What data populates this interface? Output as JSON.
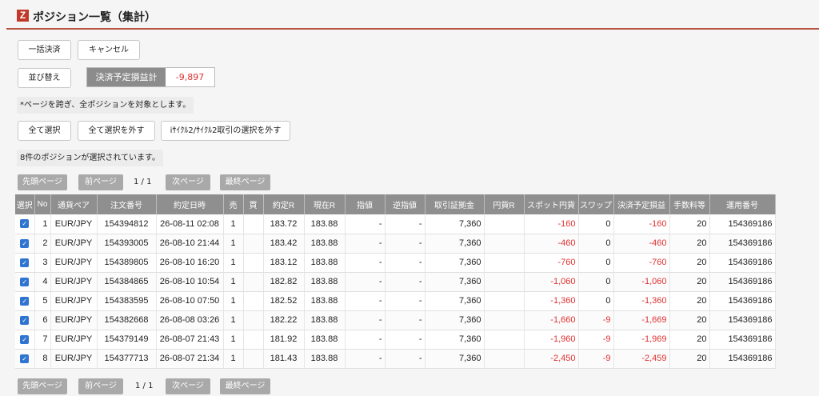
{
  "header": {
    "logo": "Z",
    "title": "ポジション一覧（集計）"
  },
  "actions": {
    "bulk_settle": "一括決済",
    "cancel": "キャンセル",
    "sort": "並び替え",
    "pl_label": "決済予定損益計",
    "pl_value": "-9,897"
  },
  "notes": {
    "scope": "*ページを跨ぎ、全ポジションを対象とします。",
    "selected_count": "8件のポジションが選択されています。"
  },
  "selection": {
    "select_all": "全て選択",
    "deselect_all": "全て選択を外す",
    "deselect_icycle": "iｻｲｸﾙ2/ｻｲｸﾙ2取引の選択を外す"
  },
  "pager": {
    "first": "先頭ページ",
    "prev": "前ページ",
    "indicator": "1 / 1",
    "next": "次ページ",
    "last": "最終ページ"
  },
  "table": {
    "headers": [
      "選択",
      "No",
      "通貨ペア",
      "注文番号",
      "約定日時",
      "売",
      "買",
      "約定R",
      "現在R",
      "指値",
      "逆指値",
      "取引証拠金",
      "円貨R",
      "スポット円貨",
      "スワップ",
      "決済予定損益",
      "手数料等",
      "運用番号"
    ],
    "rows": [
      [
        "1",
        "EUR/JPY",
        "154394812",
        "26-08-11 02:08",
        "1",
        "",
        "183.72",
        "183.88",
        "-",
        "-",
        "7,360",
        "",
        "-160",
        "0",
        "-160",
        "20",
        "154369186"
      ],
      [
        "2",
        "EUR/JPY",
        "154393005",
        "26-08-10 21:44",
        "1",
        "",
        "183.42",
        "183.88",
        "-",
        "-",
        "7,360",
        "",
        "-460",
        "0",
        "-460",
        "20",
        "154369186"
      ],
      [
        "3",
        "EUR/JPY",
        "154389805",
        "26-08-10 16:20",
        "1",
        "",
        "183.12",
        "183.88",
        "-",
        "-",
        "7,360",
        "",
        "-760",
        "0",
        "-760",
        "20",
        "154369186"
      ],
      [
        "4",
        "EUR/JPY",
        "154384865",
        "26-08-10 10:54",
        "1",
        "",
        "182.82",
        "183.88",
        "-",
        "-",
        "7,360",
        "",
        "-1,060",
        "0",
        "-1,060",
        "20",
        "154369186"
      ],
      [
        "5",
        "EUR/JPY",
        "154383595",
        "26-08-10 07:50",
        "1",
        "",
        "182.52",
        "183.88",
        "-",
        "-",
        "7,360",
        "",
        "-1,360",
        "0",
        "-1,360",
        "20",
        "154369186"
      ],
      [
        "6",
        "EUR/JPY",
        "154382668",
        "26-08-08 03:26",
        "1",
        "",
        "182.22",
        "183.88",
        "-",
        "-",
        "7,360",
        "",
        "-1,660",
        "-9",
        "-1,669",
        "20",
        "154369186"
      ],
      [
        "7",
        "EUR/JPY",
        "154379149",
        "26-08-07 21:43",
        "1",
        "",
        "181.92",
        "183.88",
        "-",
        "-",
        "7,360",
        "",
        "-1,960",
        "-9",
        "-1,969",
        "20",
        "154369186"
      ],
      [
        "8",
        "EUR/JPY",
        "154377713",
        "26-08-07 21:34",
        "1",
        "",
        "181.43",
        "183.88",
        "-",
        "-",
        "7,360",
        "",
        "-2,450",
        "-9",
        "-2,459",
        "20",
        "154369186"
      ]
    ]
  },
  "colors": {
    "accent": "#c0392b",
    "negative": "#e03131",
    "header_bg": "#8f8f8f",
    "checkbox": "#2f74d0"
  }
}
